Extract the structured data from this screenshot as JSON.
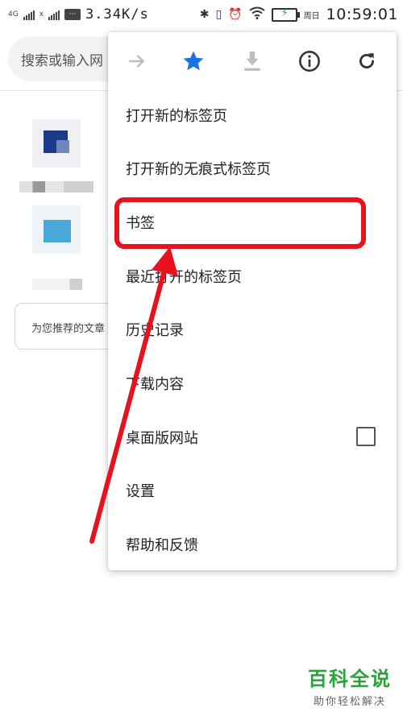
{
  "status_bar": {
    "network_1": "4G",
    "network_2": "x",
    "speed": "3.34K/s",
    "weekday": "周日",
    "time": "10:59:01",
    "icons": [
      "signal-icon",
      "message-icon",
      "bluetooth-icon",
      "vibrate-icon",
      "alarm-icon",
      "wifi-icon",
      "battery-icon"
    ]
  },
  "omnibox": {
    "placeholder": "搜索或输入网"
  },
  "suggest_card": {
    "text": "为您推荐的文章"
  },
  "menu": {
    "toolbar_icons": [
      "forward-icon",
      "star-icon",
      "download-icon",
      "info-icon",
      "refresh-icon"
    ],
    "items": [
      {
        "label": "打开新的标签页"
      },
      {
        "label": "打开新的无痕式标签页"
      },
      {
        "label": "书签"
      },
      {
        "label": "最近打开的标签页"
      },
      {
        "label": "历史记录"
      },
      {
        "label": "下载内容"
      },
      {
        "label": "桌面版网站",
        "checked": false
      },
      {
        "label": "设置"
      },
      {
        "label": "帮助和反馈"
      }
    ]
  },
  "colors": {
    "highlight": "#e8121e",
    "star": "#1a73e8",
    "watermark": "#2aa23a"
  },
  "watermark": {
    "title": "百科全说",
    "subtitle": "助你轻松解决"
  }
}
